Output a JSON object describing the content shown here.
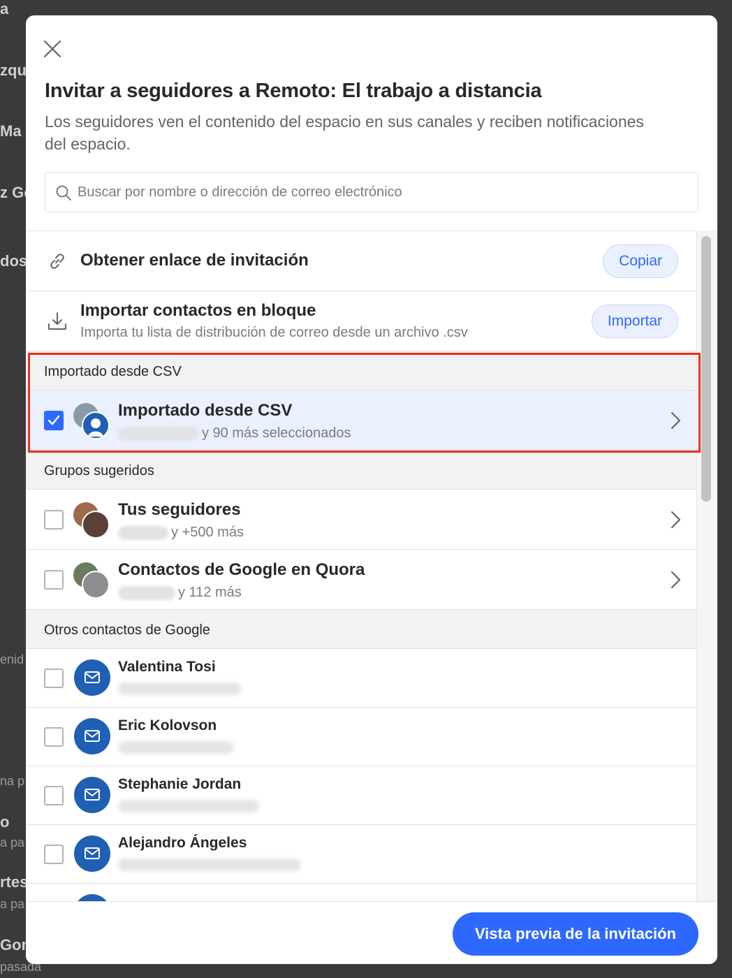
{
  "background": {
    "fragments": [
      "a",
      "zqu",
      "Ma",
      "z Go",
      "dos",
      "enid",
      "na p",
      "o",
      "a pa",
      "rtes",
      "a pa",
      "Gon",
      "pasada"
    ]
  },
  "modal": {
    "title": "Invitar a seguidores a Remoto: El trabajo a distancia",
    "subtitle": "Los seguidores ven el contenido del espacio en sus canales y reciben notificaciones del espacio.",
    "search": {
      "placeholder": "Buscar por nombre o dirección de correo electrónico",
      "value": ""
    },
    "invite_link": {
      "label": "Obtener enlace de invitación",
      "button": "Copiar",
      "icon": "link-icon"
    },
    "bulk_import": {
      "label": "Importar contactos en bloque",
      "description": "Importa tu lista de distribución de correo desde un archivo .csv",
      "button": "Importar",
      "icon": "download-icon"
    },
    "sections": {
      "csv": {
        "header": "Importado desde CSV",
        "item": {
          "title": "Importado desde CSV",
          "subtitle": "y 90 más seleccionados",
          "checked": true
        }
      },
      "suggested": {
        "header": "Grupos sugeridos",
        "items": [
          {
            "title": "Tus seguidores",
            "subtitle": "y +500 más",
            "checked": false
          },
          {
            "title": "Contactos de Google en Quora",
            "subtitle": "y 112 más",
            "checked": false
          }
        ]
      },
      "google_contacts": {
        "header": "Otros contactos de Google",
        "items": [
          {
            "name": "Valentina Tosi",
            "checked": false
          },
          {
            "name": "Eric Kolovson",
            "checked": false
          },
          {
            "name": "Stephanie Jordan",
            "checked": false
          },
          {
            "name": "Alejandro Ángeles",
            "checked": false
          }
        ]
      }
    },
    "primary_button": "Vista previa de la invitación"
  },
  "colors": {
    "accent": "#2e69ff",
    "highlight": "#e8321f",
    "mail_avatar": "#1f5fb4"
  }
}
